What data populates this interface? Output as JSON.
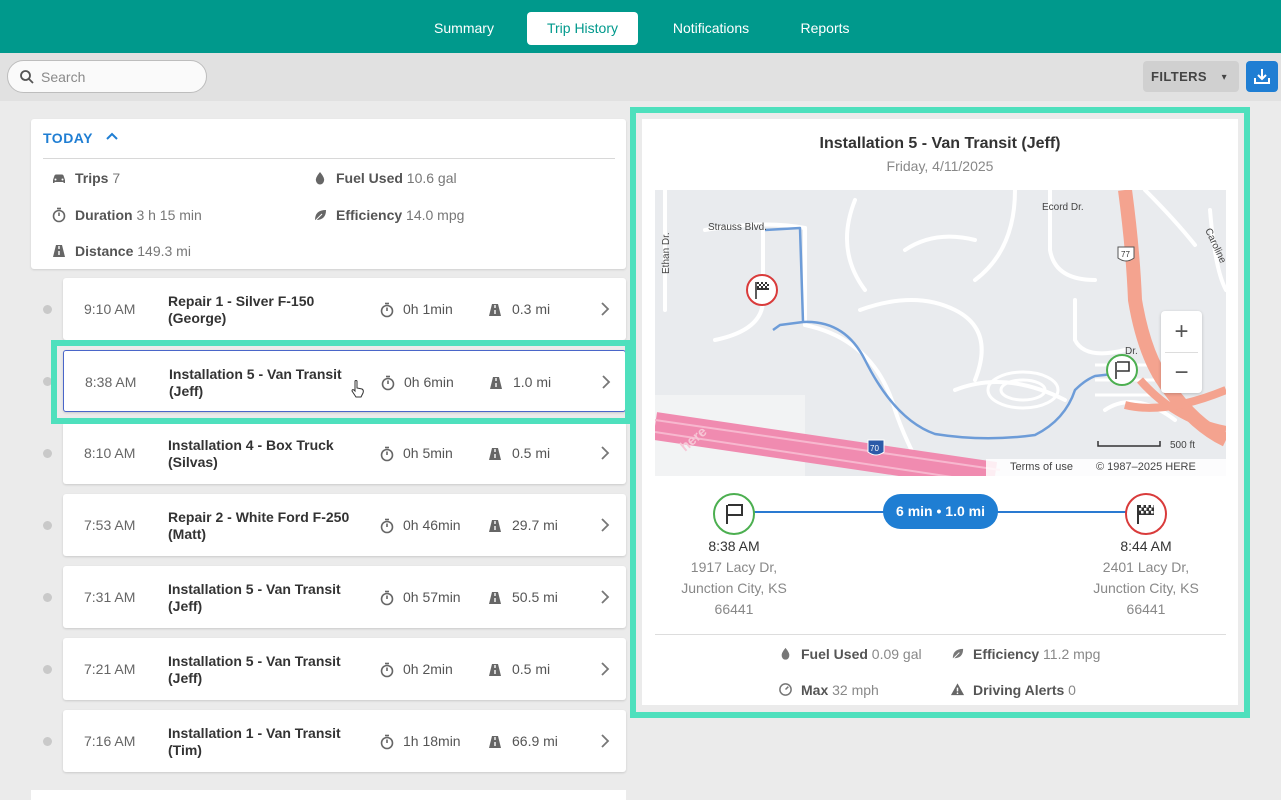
{
  "nav": {
    "tabs": [
      {
        "label": "Summary",
        "active": false
      },
      {
        "label": "Trip History",
        "active": true
      },
      {
        "label": "Notifications",
        "active": false
      },
      {
        "label": "Reports",
        "active": false
      }
    ]
  },
  "toolbar": {
    "search_placeholder": "Search",
    "filters_label": "FILTERS"
  },
  "summary": {
    "header": "TODAY",
    "trips_label": "Trips",
    "trips_value": "7",
    "fuel_label": "Fuel Used",
    "fuel_value": "10.6 gal",
    "duration_label": "Duration",
    "duration_value": "3 h 15 min",
    "efficiency_label": "Efficiency",
    "efficiency_value": "14.0 mpg",
    "distance_label": "Distance",
    "distance_value": "149.3 mi"
  },
  "trips": [
    {
      "time": "9:10 AM",
      "name": "Repair 1 - Silver F-150 (George)",
      "duration": "0h 1min",
      "distance": "0.3 mi"
    },
    {
      "time": "8:38 AM",
      "name": "Installation 5 - Van Transit (Jeff)",
      "duration": "0h 6min",
      "distance": "1.0 mi",
      "selected": true
    },
    {
      "time": "8:10 AM",
      "name": "Installation 4 - Box Truck (Silvas)",
      "duration": "0h 5min",
      "distance": "0.5 mi"
    },
    {
      "time": "7:53 AM",
      "name": "Repair 2 - White Ford F-250 (Matt)",
      "duration": "0h 46min",
      "distance": "29.7 mi"
    },
    {
      "time": "7:31 AM",
      "name": "Installation 5 - Van Transit (Jeff)",
      "duration": "0h 57min",
      "distance": "50.5 mi"
    },
    {
      "time": "7:21 AM",
      "name": "Installation 5 - Van Transit (Jeff)",
      "duration": "0h 2min",
      "distance": "0.5 mi"
    },
    {
      "time": "7:16 AM",
      "name": "Installation 1 - Van Transit (Tim)",
      "duration": "1h 18min",
      "distance": "66.9 mi"
    }
  ],
  "detail": {
    "title": "Installation 5 - Van Transit (Jeff)",
    "date": "Friday, 4/11/2025",
    "map": {
      "streets": [
        "Strauss Blvd.",
        "Ethan Dr.",
        "Ecord Dr.",
        "Caroline",
        "Dr."
      ],
      "highway_shields": [
        "77",
        "70"
      ],
      "zoom_in": "+",
      "zoom_out": "−",
      "scale": "500 ft",
      "terms": "Terms of use",
      "copyright": "© 1987–2025 HERE",
      "watermark": "here"
    },
    "pill": "6 min • 1.0 mi",
    "start": {
      "time": "8:38 AM",
      "address": "1917 Lacy Dr, Junction City, KS 66441"
    },
    "end": {
      "time": "8:44 AM",
      "address": "2401 Lacy Dr, Junction City, KS 66441"
    },
    "fuel_label": "Fuel Used",
    "fuel_value": "0.09 gal",
    "efficiency_label": "Efficiency",
    "efficiency_value": "11.2 mpg",
    "max_label": "Max",
    "max_value": "32 mph",
    "alerts_label": "Driving Alerts",
    "alerts_value": "0"
  },
  "colors": {
    "brand": "#00998c",
    "accent": "#1f7ed3",
    "highlight": "#4ee0bd",
    "start": "#4caf50",
    "end": "#d93b3b"
  },
  "icons": [
    "search-icon",
    "download-icon",
    "car-icon",
    "fuel-icon",
    "stopwatch-icon",
    "leaf-icon",
    "road-icon",
    "chevron-right-icon",
    "start-flag-icon",
    "finish-flag-icon",
    "speedometer-icon",
    "warning-icon",
    "pointer-cursor-icon"
  ]
}
